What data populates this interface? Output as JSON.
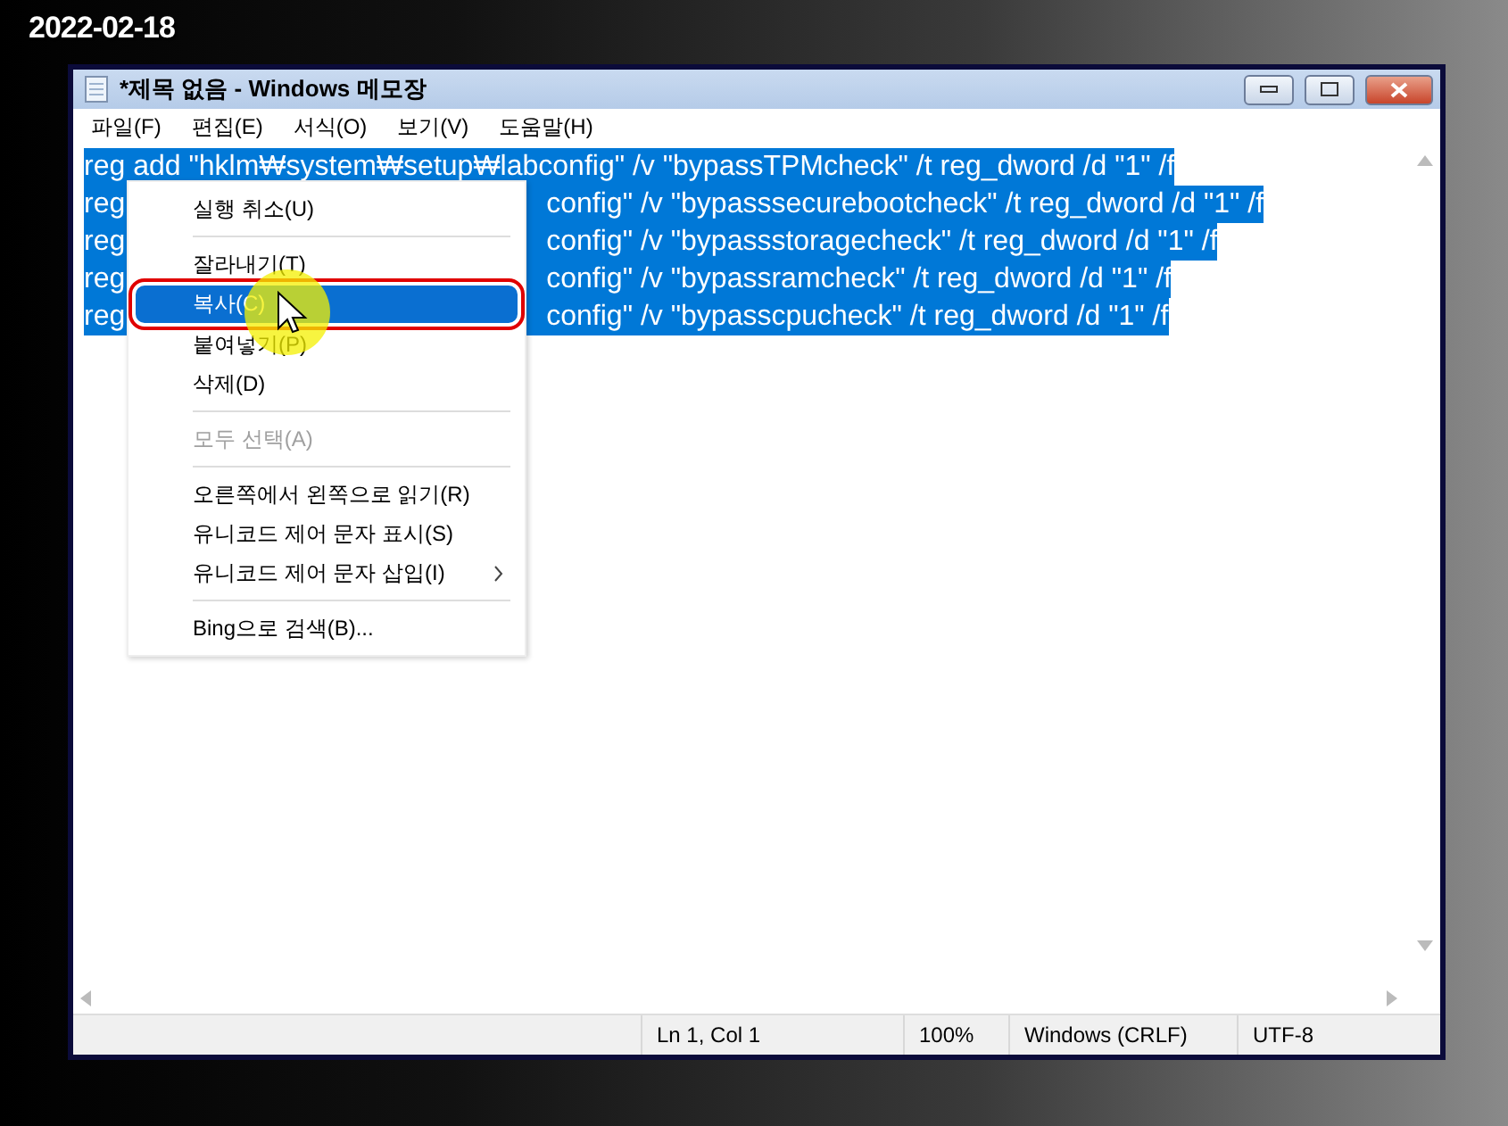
{
  "date": "2022-02-18",
  "window": {
    "title": "*제목 없음 - Windows 메모장"
  },
  "menu_bar": [
    "파일(F)",
    "편집(E)",
    "서식(O)",
    "보기(V)",
    "도움말(H)"
  ],
  "lines": [
    {
      "text": "reg add \"hklm₩system₩setup₩labconfig\" /v \"bypassTPMcheck\" /t reg_dword /d \"1\" /f",
      "selected": true
    },
    {
      "prefix": "reg",
      "suffix": "config\" /v \"bypasssecurebootcheck\" /t reg_dword /d \"1\" /f",
      "selected": true
    },
    {
      "prefix": "reg",
      "suffix": "config\" /v \"bypassstoragecheck\" /t reg_dword /d \"1\" /f",
      "selected": true
    },
    {
      "prefix": "reg",
      "suffix": "config\" /v \"bypassramcheck\" /t reg_dword /d \"1\" /f",
      "selected": true
    },
    {
      "prefix": "reg",
      "suffix": "config\" /v \"bypasscpucheck\" /t reg_dword /d \"1\" /f",
      "selected": true
    }
  ],
  "context_menu": [
    {
      "kind": "item",
      "label": "실행 취소(U)",
      "disabled": false,
      "selected": false
    },
    {
      "kind": "separator"
    },
    {
      "kind": "item",
      "label": "잘라내기(T)",
      "disabled": false,
      "selected": false
    },
    {
      "kind": "item",
      "label": "복사(C)",
      "disabled": false,
      "selected": true,
      "outlined": true
    },
    {
      "kind": "item",
      "label": "붙여넣기(P)",
      "disabled": false,
      "selected": false
    },
    {
      "kind": "item",
      "label": "삭제(D)",
      "disabled": false,
      "selected": false
    },
    {
      "kind": "separator"
    },
    {
      "kind": "item",
      "label": "모두 선택(A)",
      "disabled": true,
      "selected": false
    },
    {
      "kind": "separator"
    },
    {
      "kind": "item",
      "label": "오른쪽에서 왼쪽으로 읽기(R)",
      "disabled": false,
      "selected": false
    },
    {
      "kind": "item",
      "label": "유니코드 제어 문자 표시(S)",
      "disabled": false,
      "selected": false
    },
    {
      "kind": "item",
      "label": "유니코드 제어 문자 삽입(I)",
      "disabled": false,
      "selected": false,
      "submenu": true
    },
    {
      "kind": "separator"
    },
    {
      "kind": "item",
      "label": "Bing으로 검색(B)...",
      "disabled": false,
      "selected": false
    }
  ],
  "status_bar": [
    "Ln 1, Col 1",
    "100%",
    "Windows (CRLF)",
    "UTF-8"
  ]
}
